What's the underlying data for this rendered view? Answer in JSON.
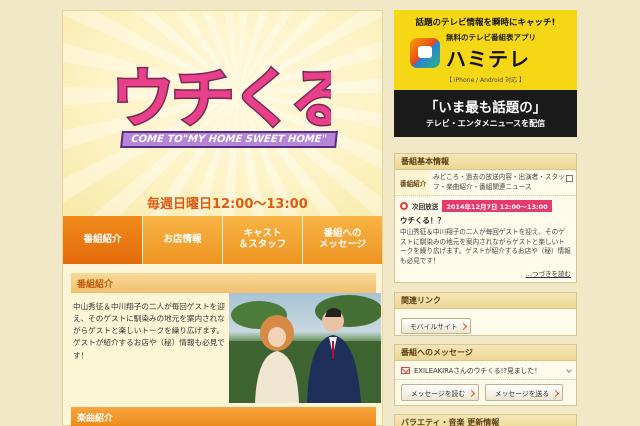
{
  "hero": {
    "logo_text": "ウチくる!?",
    "tagline": "COME TO\"MY HOME SWEET HOME\"",
    "airtime": "毎週日曜日12:00～13:00"
  },
  "nav": {
    "tabs": [
      {
        "label": "番組紹介",
        "active": true
      },
      {
        "label": "お店情報",
        "active": false
      },
      {
        "label": "キャスト\n＆スタッフ",
        "active": false
      },
      {
        "label": "番組への\nメッセージ",
        "active": false
      }
    ]
  },
  "content": {
    "section_title": "番組紹介",
    "intro": "中山秀征＆中川翔子の二人が毎回ゲストを迎え、そのゲストに馴染みの地元を案内されながらゲストと楽しいトークを繰り広げます。ゲストが紹介するお店や（秘）情報も必見です！",
    "section2_title": "楽曲紹介"
  },
  "sidebar": {
    "ad": {
      "line1": "話題のテレビ情報を瞬時にキャッチ!",
      "sub": "無料のテレビ番組表アプリ",
      "app_name": "ハミテレ",
      "platform": "【 iPhone / Android 対応 】",
      "headline": "「いま最も話題の」",
      "caption": "テレビ・エンタメニュースを配信"
    },
    "basic_info": {
      "title": "番組基本情報",
      "row_label": "番組紹介",
      "row_value": "みどころ・過去の放送内容・出演者・スタッフ・楽曲紹介・番組関連ニュース",
      "next_label": "次回放送",
      "next_date": "2014年12月7日 12:00～13:00",
      "next_title": "ウチくる！？",
      "next_desc": "中山秀征＆中川翔子の二人が毎回ゲストを迎え、そのゲストに馴染みの地元を案内されながらゲストと楽しいトークを繰り広げます。ゲストが紹介するお店や（秘）情報も必見です！",
      "more": "…つづきを読む"
    },
    "links": {
      "title": "関連リンク",
      "mobile": "モバイルサイト"
    },
    "messages": {
      "title": "番組へのメッセージ",
      "latest": "EXILEAKIRAさんのウチくる!?見ました！",
      "read": "メッセージを読む",
      "send": "メッセージを送る"
    },
    "genre": {
      "title": "バラエティ・音楽 更新情報"
    }
  },
  "colors": {
    "accent_orange": "#ee9422",
    "active_tab": "#e46b0a",
    "date_badge": "#e63a6e",
    "ad_yellow": "#f6d715"
  }
}
